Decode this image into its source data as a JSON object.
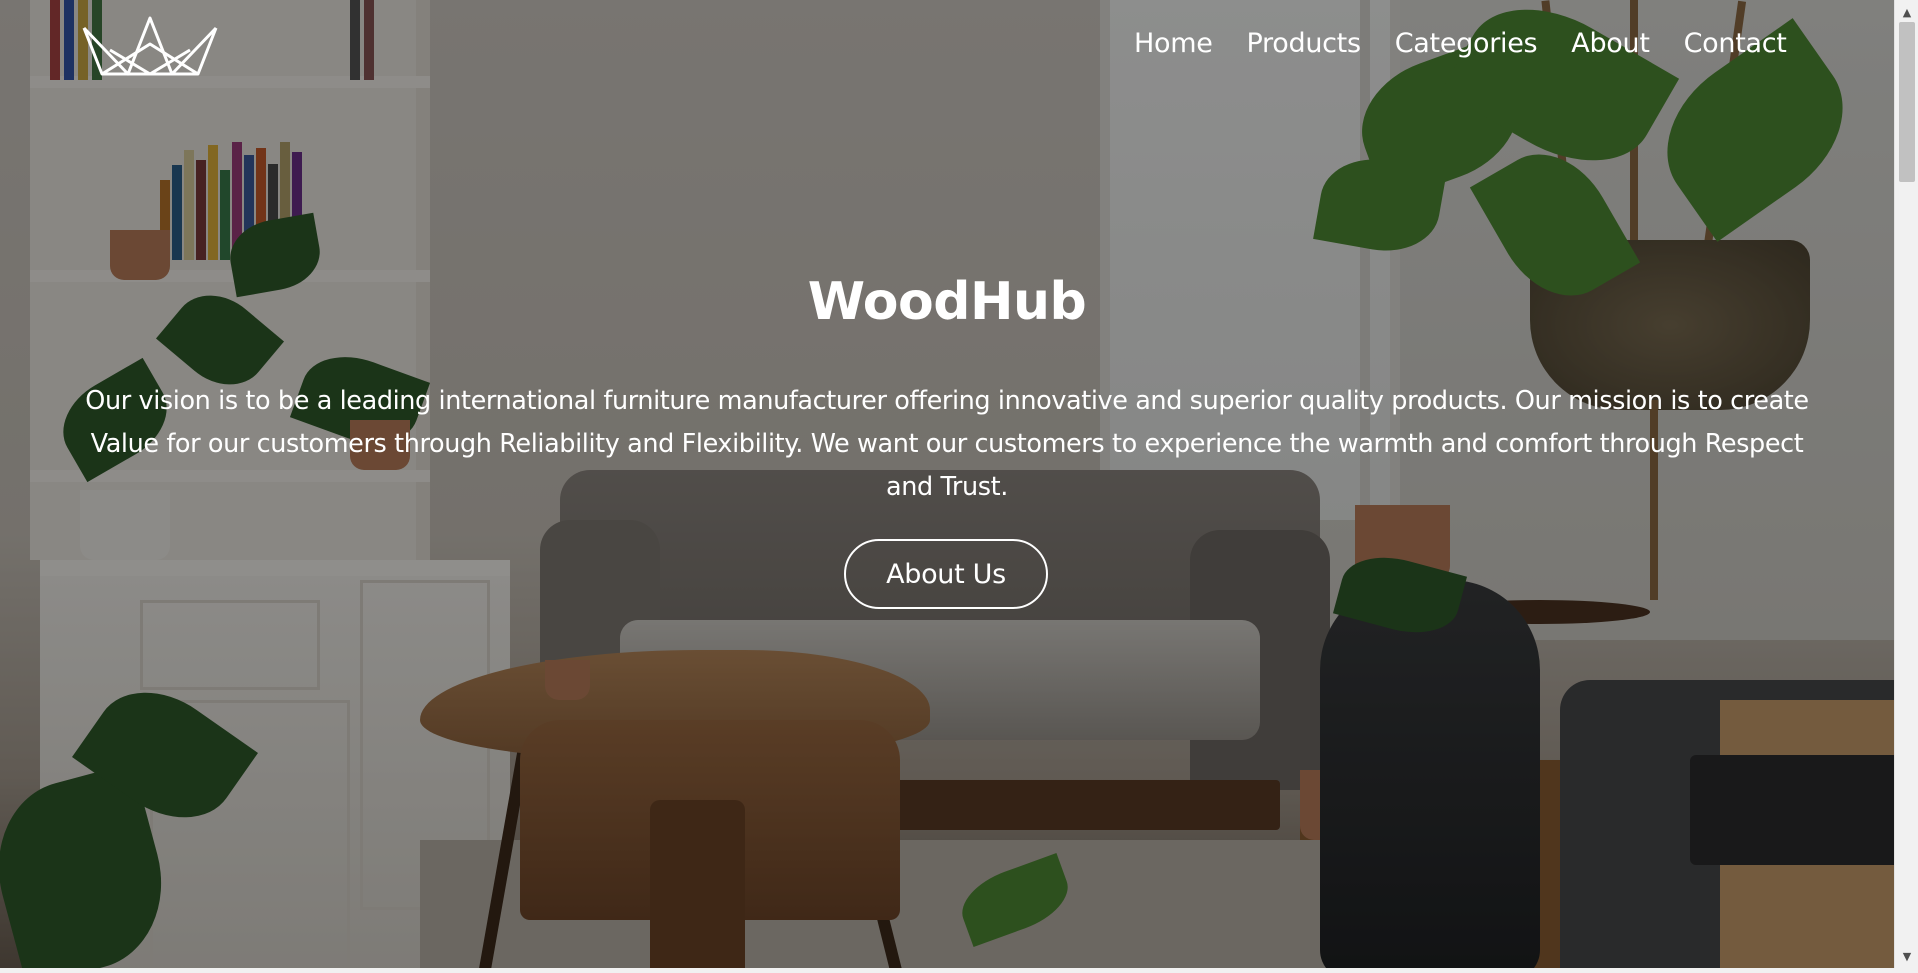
{
  "brand": {
    "logo_icon": "crown-icon"
  },
  "nav": {
    "items": [
      {
        "label": "Home"
      },
      {
        "label": "Products"
      },
      {
        "label": "Categories"
      },
      {
        "label": "About"
      },
      {
        "label": "Contact"
      }
    ]
  },
  "hero": {
    "title": "WoodHub",
    "text": "Our vision is to be a leading international furniture manufacturer offering innovative and superior quality products. Our mission is to create Value for our customers through Reliability and Flexibility. We want our customers to experience the warmth and comfort through Respect and Trust.",
    "button_label": "About Us",
    "background_image": "living-room-photo"
  },
  "scrollbar": {
    "up_icon": "▲",
    "down_icon": "▼"
  },
  "colors": {
    "text": "#ffffff",
    "overlay": "rgba(0,0,0,0.42)"
  }
}
